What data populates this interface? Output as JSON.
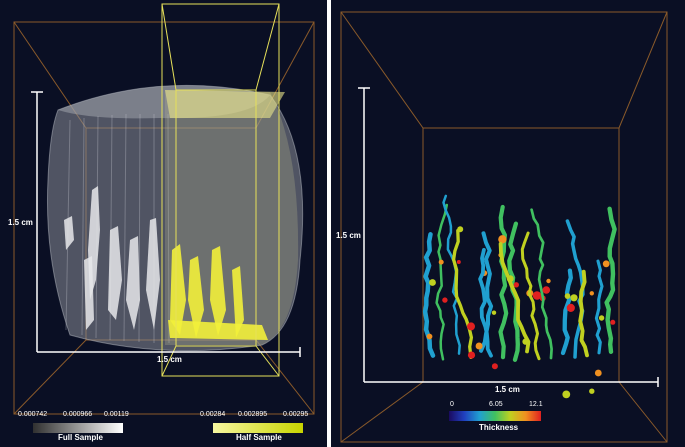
{
  "colors": {
    "background": "#0a0f24",
    "box_edge": "#8a5a2a",
    "yellow_box": "#e6e05a",
    "axis_line": "#ffffff"
  },
  "left_panel": {
    "vertical_scale_label": "1.5 cm",
    "horizontal_scale_label": "1.5 cm",
    "full_sample": {
      "title": "Full Sample",
      "ticks": [
        "0.000742",
        "0.000966",
        "0.00119"
      ],
      "gradient": [
        "#303030",
        "#ffffff"
      ]
    },
    "half_sample": {
      "title": "Half Sample",
      "ticks": [
        "0.00284",
        "0.002895",
        "0.00295"
      ],
      "gradient": [
        "#f7f7a0",
        "#c8d400"
      ]
    }
  },
  "right_panel": {
    "vertical_scale_label": "1.5 cm",
    "horizontal_scale_label": "1.5 cm",
    "thickness": {
      "title": "Thickness",
      "ticks": [
        "0",
        "6.05",
        "12.1"
      ],
      "gradient": [
        "#1a0a60",
        "#2040c0",
        "#20a0d0",
        "#40c060",
        "#c0d020",
        "#f09020",
        "#e02020"
      ]
    }
  }
}
